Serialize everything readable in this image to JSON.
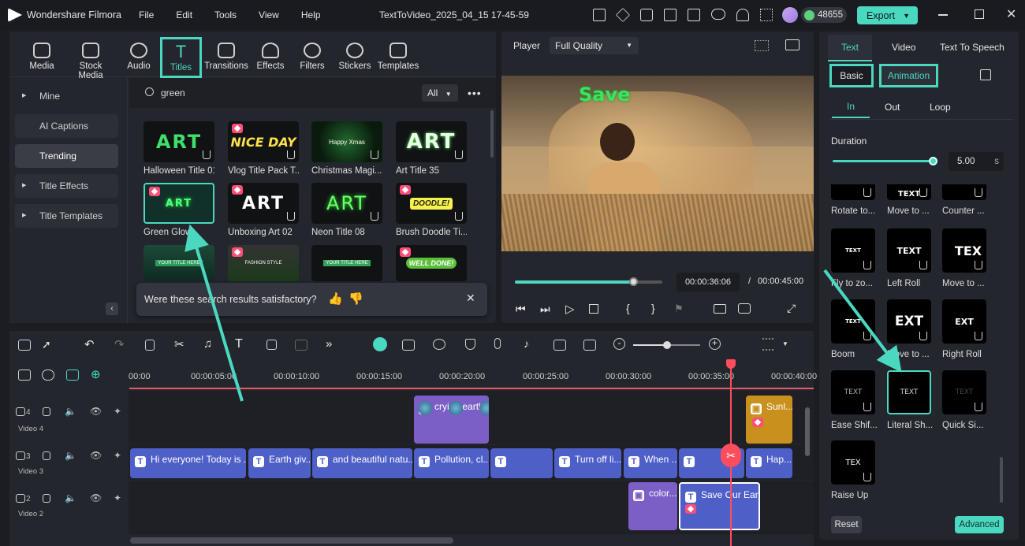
{
  "app": {
    "title": "Wondershare Filmora",
    "project": "TextToVideo_2025_04_15 17-45-59",
    "credits": "48655",
    "export_label": "Export"
  },
  "menu": [
    "File",
    "Edit",
    "Tools",
    "View",
    "Help"
  ],
  "media_tabs": [
    {
      "label": "Media",
      "icon": "media-icon"
    },
    {
      "label": "Stock Media",
      "icon": "stock-media-icon"
    },
    {
      "label": "Audio",
      "icon": "audio-icon"
    },
    {
      "label": "Titles",
      "icon": "titles-icon",
      "active": true
    },
    {
      "label": "Transitions",
      "icon": "transitions-icon"
    },
    {
      "label": "Effects",
      "icon": "effects-icon"
    },
    {
      "label": "Filters",
      "icon": "filters-icon"
    },
    {
      "label": "Stickers",
      "icon": "stickers-icon"
    },
    {
      "label": "Templates",
      "icon": "templates-icon"
    }
  ],
  "sidebar": [
    "Mine",
    "AI Captions",
    "Trending",
    "Title Effects",
    "Title Templates"
  ],
  "search": {
    "value": "green",
    "filter": "All"
  },
  "title_cards": [
    {
      "label": "Halloween Title 01",
      "art": "ART"
    },
    {
      "label": "Vlog Title Pack T...",
      "art": "NICE DAY"
    },
    {
      "label": "Christmas Magi...",
      "art": "Happy Xmas"
    },
    {
      "label": "Art Title 35",
      "art": "ART"
    },
    {
      "label": "Green Glow",
      "art": "ART"
    },
    {
      "label": "Unboxing Art 02",
      "art": "ART"
    },
    {
      "label": "Neon Title 08",
      "art": "ART"
    },
    {
      "label": "Brush Doodle Ti...",
      "art": "DOODLE!"
    },
    {
      "label": "",
      "art": "YOUR TITLE HERE"
    },
    {
      "label": "",
      "art": "FASHION STYLE"
    },
    {
      "label": "",
      "art": "YOUR TITLE HERE"
    },
    {
      "label": "",
      "art": "WELL DONE!"
    }
  ],
  "feedback": {
    "text": "Were these search results satisfactory?"
  },
  "player": {
    "label": "Player",
    "quality": "Full Quality",
    "overlay_text": "Save",
    "current_time": "00:00:36:06",
    "separator": "/",
    "total_time": "00:00:45:00",
    "progress": 0.8
  },
  "right_panel": {
    "tabs": [
      "Text",
      "Video",
      "Text To Speech"
    ],
    "subtabs": [
      "Basic",
      "Animation"
    ],
    "anim_tabs": [
      "In",
      "Out",
      "Loop"
    ],
    "duration_label": "Duration",
    "duration_value": "5.00",
    "duration_unit": "s",
    "animations": [
      {
        "label": "Rotate to...",
        "glyph": ""
      },
      {
        "label": "Move to ...",
        "glyph": "TEXT"
      },
      {
        "label": "Counter ...",
        "glyph": ""
      },
      {
        "label": "Fly to zo...",
        "glyph": "TEXT"
      },
      {
        "label": "Left Roll",
        "glyph": "TEXT"
      },
      {
        "label": "Move to ...",
        "glyph": "TEX"
      },
      {
        "label": "Boom",
        "glyph": "TEXT"
      },
      {
        "label": "Move to ...",
        "glyph": "EXT"
      },
      {
        "label": "Right Roll",
        "glyph": "EXT"
      },
      {
        "label": "Ease Shif...",
        "glyph": "TEXT"
      },
      {
        "label": "Literal Sh...",
        "glyph": "TEXT"
      },
      {
        "label": "Quick Si...",
        "glyph": "TEXT"
      },
      {
        "label": "Raise Up",
        "glyph": "TEX"
      }
    ],
    "reset_label": "Reset",
    "advanced_label": "Advanced"
  },
  "timeline": {
    "ruler": [
      "00:00",
      "00:00:05:00",
      "00:00:10:00",
      "00:00:15:00",
      "00:00:20:00",
      "00:00:25:00",
      "00:00:30:00",
      "00:00:35:00",
      "00:00:40:00"
    ],
    "tracks": [
      {
        "num": "4",
        "name": "Video 4"
      },
      {
        "num": "3",
        "name": "Video 3"
      },
      {
        "num": "2",
        "name": "Video 2"
      }
    ],
    "clips_v4": [
      "crying earth",
      "Sunl..."
    ],
    "clips_v3": [
      "Hi everyone! Today is ...",
      "Earth giv...",
      "and beautiful natu...",
      "Pollution, cl...",
      "",
      "Turn off li...",
      "When ...",
      "",
      "Hap..."
    ],
    "clips_v2": [
      "color...",
      "Save Our Earth"
    ]
  },
  "colors": {
    "accent": "#4bd8c0",
    "clip_text": "#4e5fc8",
    "clip_media": "#7b5fc6",
    "clip_orange": "#c9901e",
    "playhead": "#ff4d5e"
  }
}
